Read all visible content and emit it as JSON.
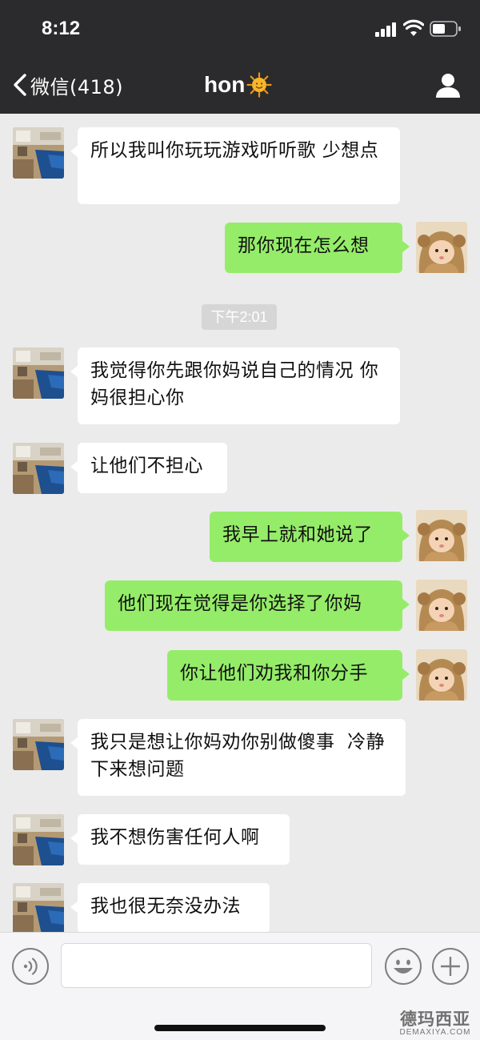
{
  "status_bar": {
    "time": "8:12"
  },
  "nav": {
    "back_label": "微信(418)",
    "title": "hon"
  },
  "timestamp": "下午2:01",
  "messages": [
    {
      "side": "left",
      "text": "所以我叫你玩玩游戏听听歌 少想点"
    },
    {
      "side": "right",
      "text": "那你现在怎么想"
    },
    {
      "side": "left",
      "text": "我觉得你先跟你妈说自己的情况 你妈很担心你"
    },
    {
      "side": "left",
      "text": "让他们不担心"
    },
    {
      "side": "right",
      "text": "我早上就和她说了"
    },
    {
      "side": "right",
      "text": "他们现在觉得是你选择了你妈"
    },
    {
      "side": "right",
      "text": "你让他们劝我和你分手"
    },
    {
      "side": "left",
      "text": "我只是想让你妈劝你别做傻事  冷静下来想问题"
    },
    {
      "side": "left",
      "text": "我不想伤害任何人啊"
    },
    {
      "side": "left",
      "text": "我也很无奈没办法"
    }
  ],
  "input": {
    "value": "",
    "placeholder": ""
  },
  "watermark": {
    "cn": "德玛西亚",
    "en": "DEMAXIYA.COM"
  },
  "colors": {
    "header_bg": "#2b2b2d",
    "chat_bg": "#ebebeb",
    "bubble_sent": "#95ec69",
    "bubble_received": "#ffffff",
    "timestamp_bg": "#d6d6d6"
  },
  "icons": {
    "back": "chevron-left-icon",
    "title_emoji": "sun-icon",
    "profile": "person-icon",
    "voice": "voice-icon",
    "emoji": "smiley-icon",
    "more": "plus-icon"
  }
}
